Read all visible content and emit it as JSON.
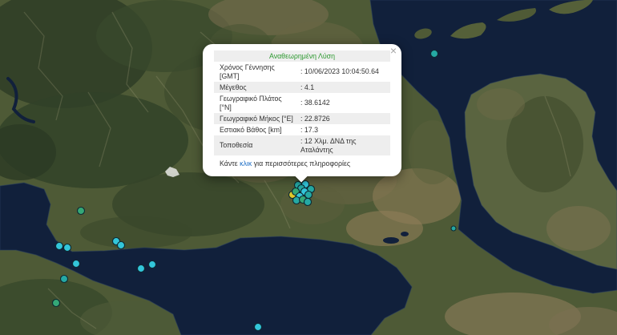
{
  "popup": {
    "title": "Αναθεωρημένη Λύση",
    "close": "×",
    "separator": ":",
    "rows": [
      {
        "label": "Χρόνος Γέννησης\n[GMT]",
        "value": "10/06/2023 10:04:50.64"
      },
      {
        "label": "Μέγεθος",
        "value": "4.1"
      },
      {
        "label": "Γεωγραφικό Πλάτος\n[°N]",
        "value": "38.6142"
      },
      {
        "label": "Γεωγραφικό Μήκος [°E]",
        "value": "22.8726"
      },
      {
        "label": "Εστιακό Βάθος [km]",
        "value": "17.3"
      },
      {
        "label": "Τοποθεσία",
        "value": "12 Χλμ. ΔΝΔ της\nΑταλάντης"
      }
    ],
    "footer": {
      "before": "Κάντε",
      "link": "κλικ",
      "after": "για περισσότερες πληροφορίες"
    }
  },
  "colors": {
    "popup_title": "#2f9a32",
    "link": "#1f6fc5",
    "sea": "#11203b",
    "marker_cyan": "#33c6da",
    "marker_teal": "#25a9a4",
    "marker_green": "#35a877",
    "marker_yellow": "#e0c92a"
  },
  "icons": {
    "close": "close-icon",
    "marker": "earthquake-marker"
  }
}
